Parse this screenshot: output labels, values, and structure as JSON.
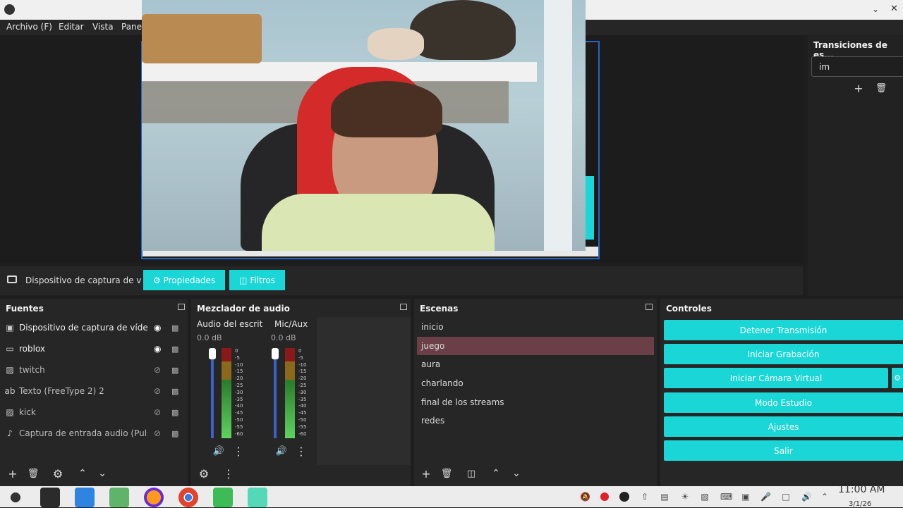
{
  "menu": [
    "Archivo (F)",
    "Editar",
    "Vista",
    "Pane"
  ],
  "source_toolbar": {
    "source_name": "Dispositivo de captura de v",
    "properties_label": "Propiedades",
    "filters_label": "Filtros"
  },
  "transitions": {
    "title": "Transiciones de es...",
    "select_value": "im"
  },
  "sources": {
    "title": "Fuentes",
    "items": [
      {
        "label": "Dispositivo de captura de vídeo",
        "icon": "camera-icon",
        "visible": true
      },
      {
        "label": "roblox",
        "icon": "monitor-icon",
        "visible": true
      },
      {
        "label": "twitch",
        "icon": "image-icon",
        "visible": false
      },
      {
        "label": "Texto (FreeType 2) 2",
        "icon": "text-icon",
        "visible": false
      },
      {
        "label": "kick",
        "icon": "image-icon",
        "visible": false
      },
      {
        "label": "Captura de entrada audio (Pulse",
        "icon": "mic-icon",
        "visible": false
      }
    ]
  },
  "mixer": {
    "title": "Mezclador de audio",
    "channels": [
      {
        "name": "Audio del escrito",
        "db": "0.0 dB"
      },
      {
        "name": "Mic/Aux",
        "db": "0.0 dB"
      }
    ],
    "scale": [
      "0",
      "-5",
      "-10",
      "-15",
      "-20",
      "-25",
      "-30",
      "-35",
      "-40",
      "-45",
      "-50",
      "-55",
      "-60"
    ]
  },
  "scenes": {
    "title": "Escenas",
    "items": [
      "inicio",
      "juego",
      "aura",
      "charlando",
      "final de los streams",
      "redes"
    ],
    "selected": "juego"
  },
  "controls": {
    "title": "Controles",
    "buttons": [
      "Detener Transmisión",
      "Iniciar Grabación",
      "Iniciar Cámara Virtual",
      "Modo Estudio",
      "Ajustes",
      "Salir"
    ]
  },
  "clock": {
    "time": "11:00 AM",
    "date": "3/1/26"
  },
  "colors": {
    "accent": "#1ad6d6",
    "selected_scene": "#6b3f47",
    "canvas_border": "#2a63c7"
  }
}
